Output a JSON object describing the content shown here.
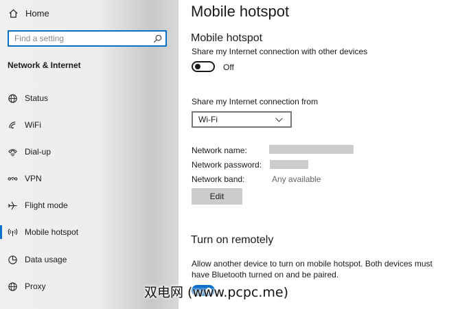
{
  "sidebar": {
    "home_label": "Home",
    "search_placeholder": "Find a setting",
    "section_title": "Network & Internet",
    "items": [
      {
        "label": "Status",
        "icon": "globe-icon"
      },
      {
        "label": "WiFi",
        "icon": "wifi-icon"
      },
      {
        "label": "Dial-up",
        "icon": "dial-up-icon"
      },
      {
        "label": "VPN",
        "icon": "vpn-icon"
      },
      {
        "label": "Flight mode",
        "icon": "airplane-icon"
      },
      {
        "label": "Mobile hotspot",
        "icon": "hotspot-icon",
        "active": true
      },
      {
        "label": "Data usage",
        "icon": "data-usage-icon"
      },
      {
        "label": "Proxy",
        "icon": "globe-icon"
      }
    ]
  },
  "main": {
    "page_title": "Mobile hotspot",
    "hotspot_heading": "Mobile hotspot",
    "share_label": "Share my Internet connection with other devices",
    "toggle_state": "Off",
    "share_from_label": "Share my Internet connection from",
    "share_from_value": "Wi-Fi",
    "network_name_label": "Network name:",
    "network_password_label": "Network password:",
    "network_band_label": "Network band:",
    "network_band_value": "Any available",
    "edit_button": "Edit",
    "remote_heading": "Turn on remotely",
    "remote_description_line1": "Allow another device to turn on mobile hotspot. Both devices must",
    "remote_description_line2": "have Bluetooth turned on and be paired."
  },
  "watermark": "双电网 (www.pcpc.me)",
  "colors": {
    "accent": "#0b6fc9",
    "button_bg": "#cccccc",
    "redaction": "#cccccc"
  }
}
